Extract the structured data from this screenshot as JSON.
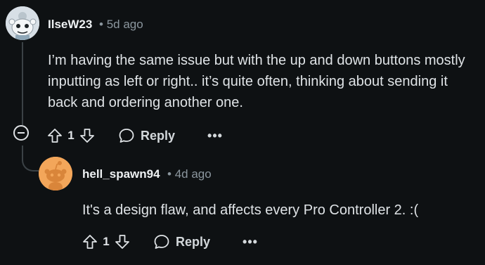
{
  "comment": {
    "username": "IlseW23",
    "separator": "•",
    "age": "5d ago",
    "body": "I’m having the same issue but with the up and down buttons mostly inputting as left or right.. it’s quite often, thinking about sending it back and ordering another one.",
    "vote_count": "1",
    "reply_label": "Reply",
    "more_label": "•••"
  },
  "reply": {
    "username": "hell_spawn94",
    "separator": "•",
    "age": "4d ago",
    "body": "It's a design flaw, and affects every Pro Controller 2. :(",
    "vote_count": "1",
    "reply_label": "Reply",
    "more_label": "•••"
  },
  "icons": {
    "upvote": "arrow-up-outline-icon",
    "downvote": "arrow-down-outline-icon",
    "reply": "speech-bubble-icon",
    "collapse": "minus-circle-icon"
  },
  "colors": {
    "background": "#0e1113",
    "text": "#dfe3e6",
    "muted": "#8b969e",
    "thread_line": "#3b4246",
    "snoo_orange": "#f3a65a"
  }
}
